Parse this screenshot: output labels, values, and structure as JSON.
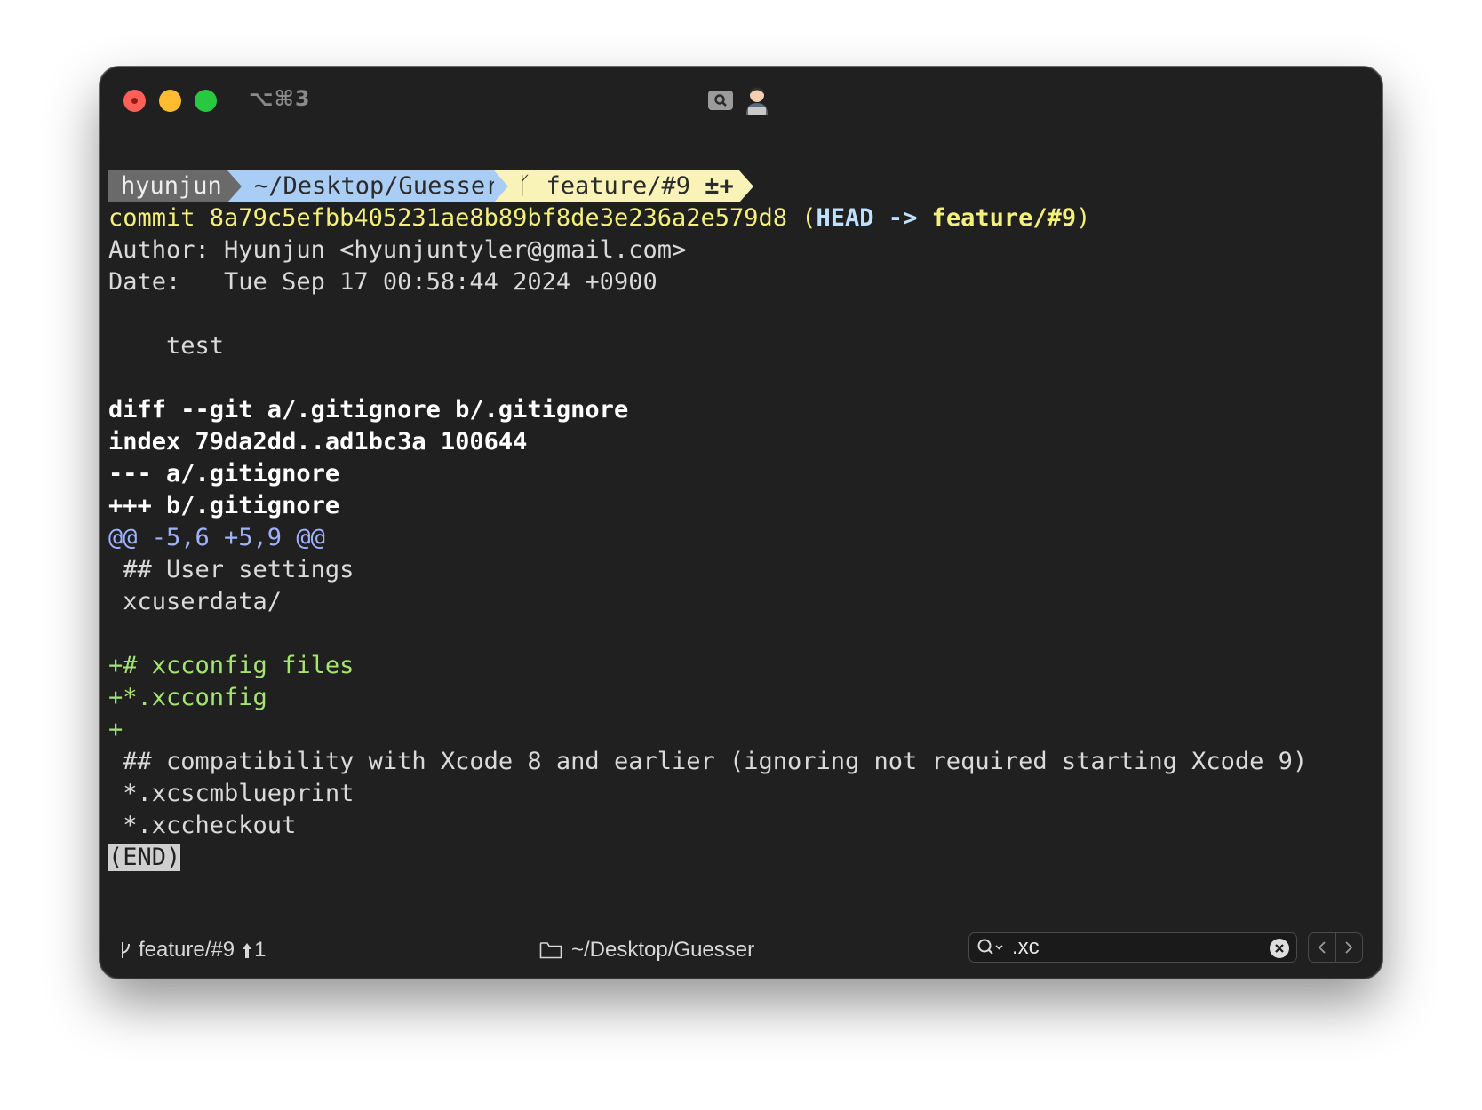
{
  "titlebar": {
    "shortcut": "⌥⌘3",
    "icons": [
      "search-badge-icon",
      "user-icon"
    ]
  },
  "prompt": {
    "user": "hyunjun",
    "path": "~/Desktop/Guesser",
    "branch_icon": "git-branch-icon",
    "branch": "feature/#9",
    "status": "±+"
  },
  "log": {
    "commit_prefix": "commit ",
    "commit_hash": "8a79c5efbb405231ae8b89bf8de3e236a2e579d8",
    "ref_open": " (",
    "head": "HEAD -> ",
    "ref_branch": "feature/#9",
    "ref_close": ")",
    "author": "Author: Hyunjun <hyunjuntyler@gmail.com>",
    "date": "Date:   Tue Sep 17 00:58:44 2024 +0900",
    "message": "    test"
  },
  "diff": {
    "header": "diff --git a/.gitignore b/.gitignore",
    "index": "index 79da2dd..ad1bc3a 100644",
    "from_file": "--- a/.gitignore",
    "to_file": "+++ b/.gitignore",
    "hunk": "@@ -5,6 +5,9 @@",
    "ctx1": " ## User settings",
    "ctx2": " xcuserdata/",
    "add1": "+# xcconfig files",
    "add2": "+*.xcconfig",
    "add3": "+",
    "ctx3": " ## compatibility with Xcode 8 and earlier (ignoring not required starting Xcode 9)",
    "ctx4": " *.xcscmblueprint",
    "ctx5": " *.xccheckout",
    "end": "(END)"
  },
  "statusbar": {
    "branch": "feature/#9",
    "ahead": "1",
    "directory": "~/Desktop/Guesser",
    "search_value": ".xc"
  }
}
